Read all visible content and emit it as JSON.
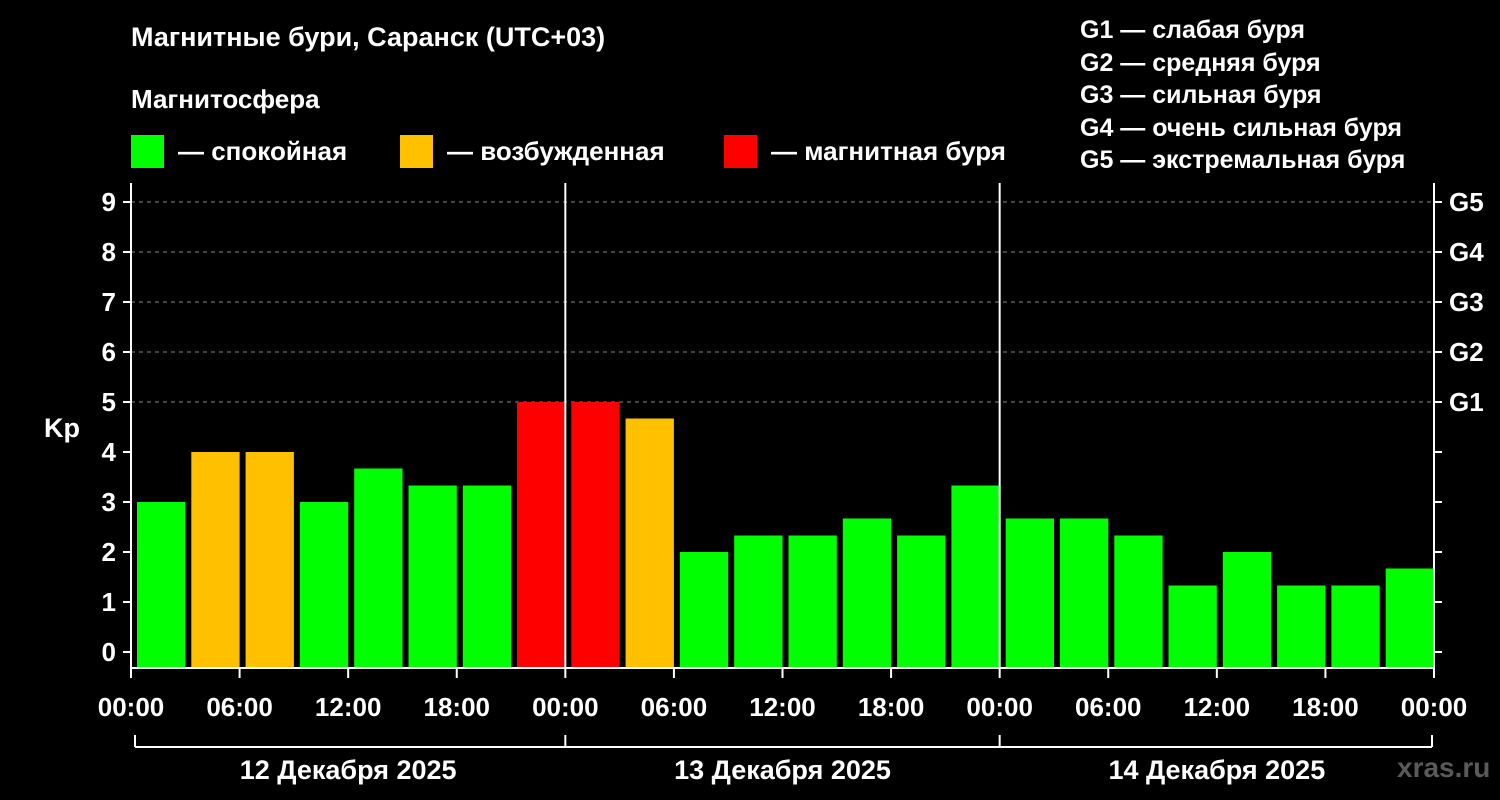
{
  "header": {
    "title": "Магнитные бури, Саранск (UTC+03)",
    "subtitle": "Магнитосфера"
  },
  "legend": [
    {
      "label": "— спокойная",
      "color": "#00ff00"
    },
    {
      "label": "— возбужденная",
      "color": "#ffc000"
    },
    {
      "label": "— магнитная буря",
      "color": "#ff0000"
    }
  ],
  "storm_levels": [
    "G1 — слабая буря",
    "G2 — средняя буря",
    "G3 — сильная буря",
    "G4 — очень сильная буря",
    "G5 — экстремальная буря"
  ],
  "brand": "xras.ru",
  "chart_data": {
    "type": "bar",
    "ylabel": "Kp",
    "ylim": [
      0,
      9
    ],
    "y_ticks": [
      "0",
      "1",
      "2",
      "3",
      "4",
      "5",
      "6",
      "7",
      "8",
      "9"
    ],
    "right_ticks": [
      {
        "value": 5,
        "label": "G1"
      },
      {
        "value": 6,
        "label": "G2"
      },
      {
        "value": 7,
        "label": "G3"
      },
      {
        "value": 8,
        "label": "G4"
      },
      {
        "value": 9,
        "label": "G5"
      }
    ],
    "x_tick_labels": [
      "00:00",
      "06:00",
      "12:00",
      "18:00",
      "00:00",
      "06:00",
      "12:00",
      "18:00",
      "00:00",
      "06:00",
      "12:00",
      "18:00",
      "00:00"
    ],
    "days": [
      "12 Декабря 2025",
      "13 Декабря 2025",
      "14 Декабря 2025"
    ],
    "grid": "dashed horizontal at 5–9",
    "values": [
      3,
      4,
      4,
      3,
      3.67,
      3.33,
      3.33,
      5,
      5,
      4.67,
      2,
      2.33,
      2.33,
      2.67,
      2.33,
      3.33,
      2.67,
      2.67,
      2.33,
      1.33,
      2,
      1.33,
      1.33,
      1.67
    ],
    "colors": [
      "#00ff00",
      "#ffc000",
      "#ffc000",
      "#00ff00",
      "#00ff00",
      "#00ff00",
      "#00ff00",
      "#ff0000",
      "#ff0000",
      "#ffc000",
      "#00ff00",
      "#00ff00",
      "#00ff00",
      "#00ff00",
      "#00ff00",
      "#00ff00",
      "#00ff00",
      "#00ff00",
      "#00ff00",
      "#00ff00",
      "#00ff00",
      "#00ff00",
      "#00ff00",
      "#00ff00"
    ]
  }
}
